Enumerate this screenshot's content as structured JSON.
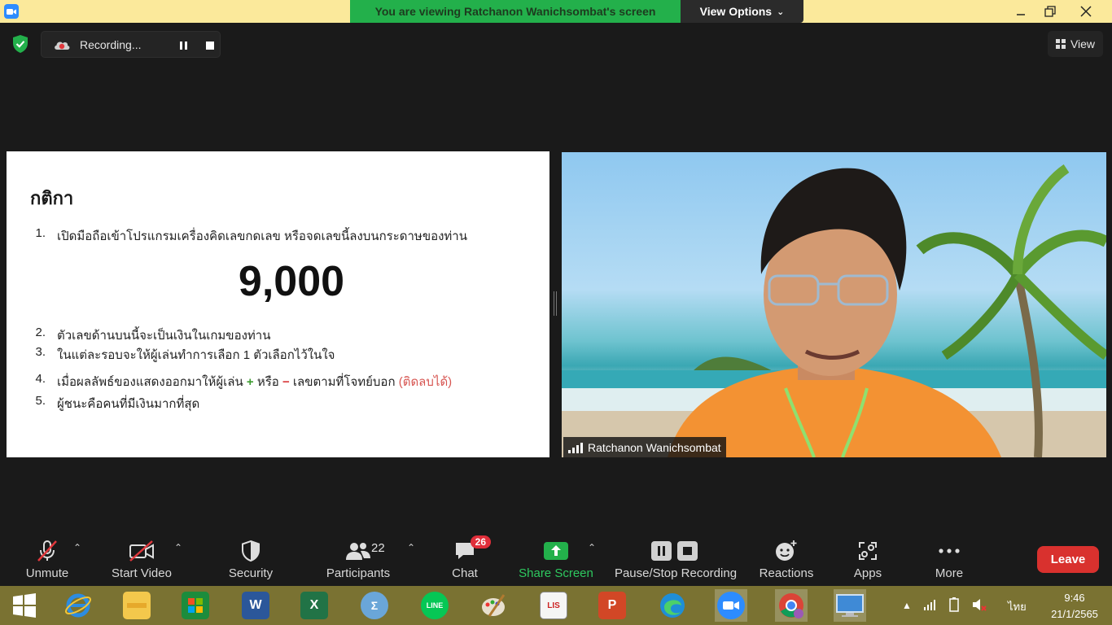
{
  "topbar": {
    "viewing_text": "You are viewing Ratchanon Wanichsombat's screen",
    "view_options_label": "View Options",
    "colors": {
      "banner": "#fbe99b",
      "viewing": "#23b04b"
    }
  },
  "recording": {
    "label": "Recording..."
  },
  "view_button": {
    "label": "View"
  },
  "slide": {
    "title": "กติกา",
    "rules": [
      {
        "num": "1.",
        "text": "เปิดมือถือเข้าโปรแกรมเครื่องคิดเลขกดเลข หรือจดเลขนี้ลงบนกระดาษของท่าน"
      },
      {
        "num": "2.",
        "text": "ตัวเลขด้านบนนี้จะเป็นเงินในเกมของท่าน"
      },
      {
        "num": "3.",
        "text": "ในแต่ละรอบจะให้ผู้เล่นทำการเลือก 1 ตัวเลือกไว้ในใจ"
      },
      {
        "num": "4.",
        "text_before": "เมื่อผลลัพธ์ของแสดงออกมาให้ผู้เล่น",
        "plus": "+",
        "or": "หรือ",
        "minus": "−",
        "text_after": "เลขตามที่โจทย์บอก",
        "note": "(ติดลบได้)"
      },
      {
        "num": "5.",
        "text": "ผู้ชนะคือคนที่มีเงินมากที่สุด"
      }
    ],
    "big_number": "9,000"
  },
  "video": {
    "participant_name": "Ratchanon Wanichsombat"
  },
  "toolbar": {
    "unmute": "Unmute",
    "start_video": "Start Video",
    "security": "Security",
    "participants": "Participants",
    "participants_count": "22",
    "chat": "Chat",
    "chat_badge": "26",
    "share_screen": "Share Screen",
    "pause_stop_recording": "Pause/Stop Recording",
    "reactions": "Reactions",
    "apps": "Apps",
    "more": "More",
    "leave": "Leave"
  },
  "taskbar": {
    "apps": [
      "start-icon",
      "ie-icon",
      "file-explorer-icon",
      "store-icon",
      "word-icon",
      "excel-icon",
      "math-input-icon",
      "line-icon",
      "paint-icon",
      "lisrel-icon",
      "powerpoint-icon",
      "edge-icon",
      "zoom-icon",
      "chrome-icon",
      "remote-desktop-icon"
    ],
    "language": "ไทย",
    "time": "9:46",
    "date": "21/1/2565"
  }
}
